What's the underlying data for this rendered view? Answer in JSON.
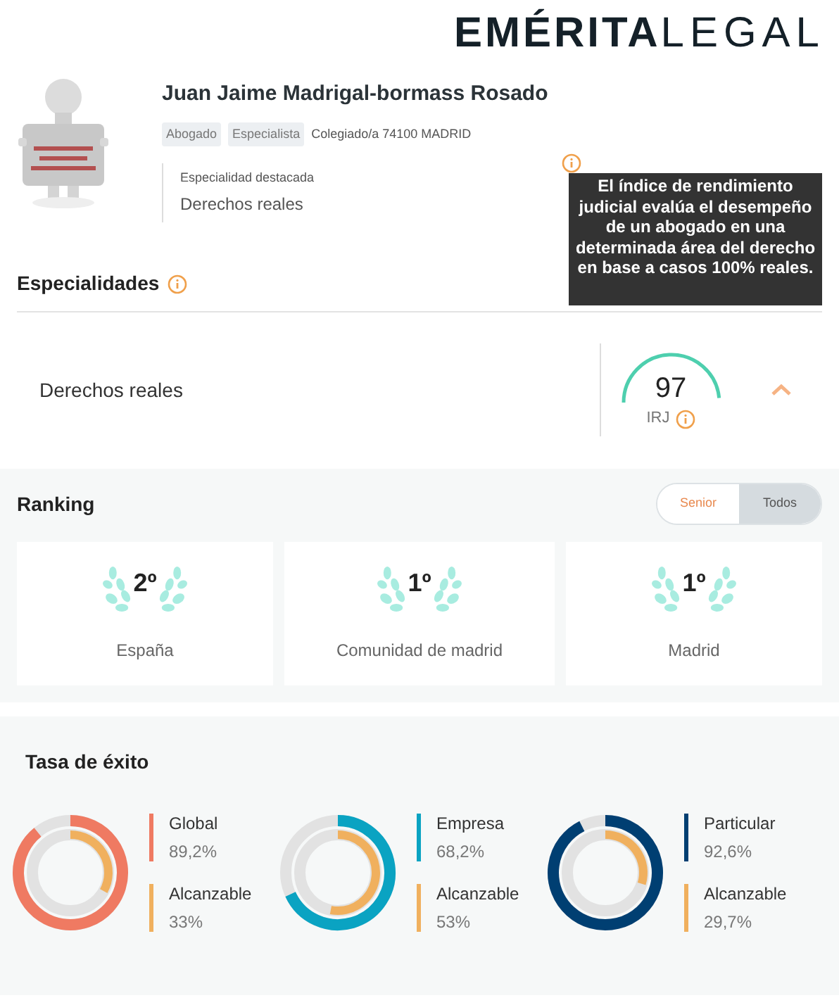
{
  "logo": {
    "bold": "EMÉRITA",
    "light": "LEGAL"
  },
  "profile": {
    "avatar": {
      "kind": "picture"
    },
    "name": "Juan Jaime Madrigal-bormass Rosado",
    "tags": [
      "Abogado",
      "Especialista"
    ],
    "registration": "Colegiado/a 74100 MADRID",
    "featured_label": "Especialidad destacada",
    "featured_value": "Derechos reales"
  },
  "tooltip": "El índice de rendimiento judicial evalúa el desempeño de un abogado en una determinada área del derecho en base a casos 100% reales.",
  "specialties": {
    "title": "Especialidades",
    "items": [
      {
        "name": "Derechos reales",
        "score": "97",
        "score_label": "IRJ",
        "expanded": true
      }
    ]
  },
  "ranking": {
    "title": "Ranking",
    "toggle": [
      {
        "label": "Senior",
        "selected": true
      },
      {
        "label": "Todos",
        "selected": false
      }
    ],
    "cards": [
      {
        "position": "2º",
        "place": "España"
      },
      {
        "position": "1º",
        "place": "Comunidad de madrid"
      },
      {
        "position": "1º",
        "place": "Madrid"
      }
    ]
  },
  "success": {
    "title": "Tasa de éxito",
    "items": [
      {
        "label": "Global",
        "value": "89,2%",
        "color": "#ef7a62",
        "reach_label": "Alcanzable",
        "reach_value": "33%"
      },
      {
        "label": "Empresa",
        "value": "68,2%",
        "color": "#0aa3c2",
        "reach_label": "Alcanzable",
        "reach_value": "53%"
      },
      {
        "label": "Particular",
        "value": "92,6%",
        "color": "#003f72",
        "reach_label": "Alcanzable",
        "reach_value": "29,7%"
      }
    ]
  }
}
